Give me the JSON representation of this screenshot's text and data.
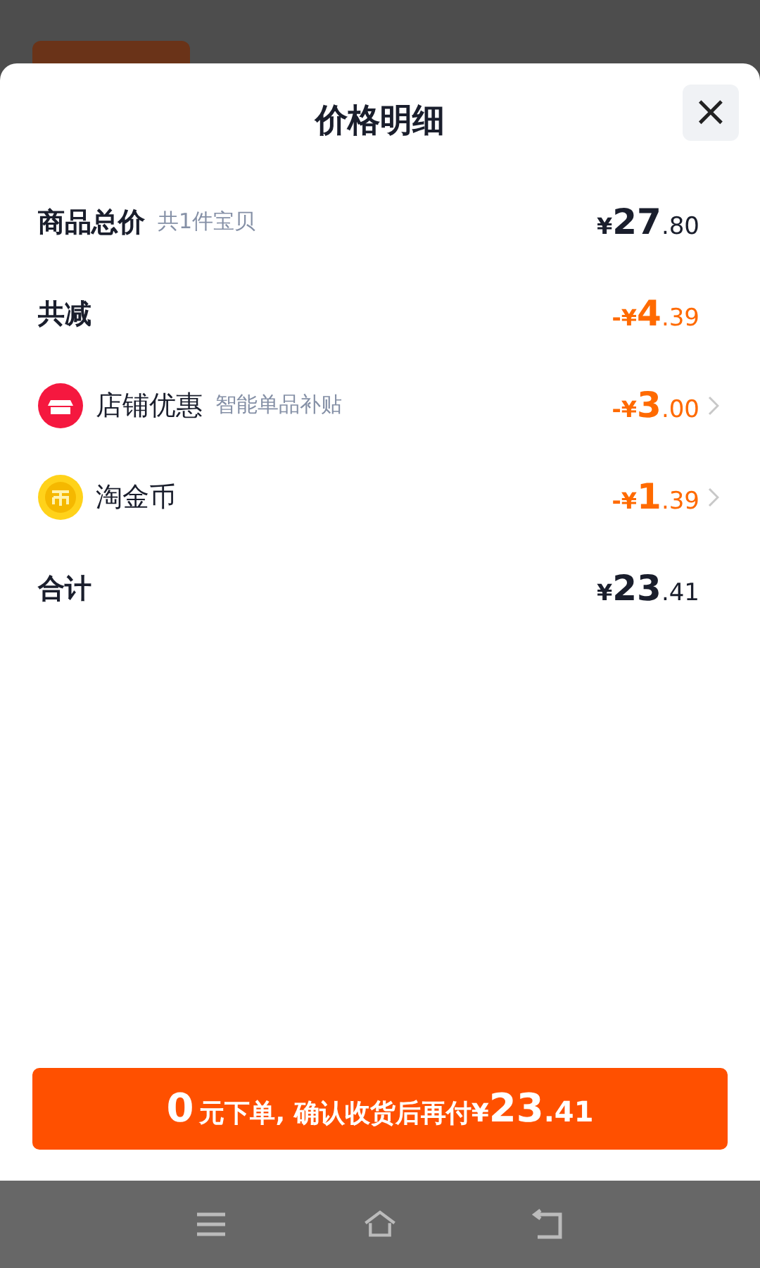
{
  "sheet": {
    "title": "价格明细",
    "close": "×"
  },
  "rows": [
    {
      "kind": "total",
      "label": "商品总价",
      "note": "共1件宝贝",
      "amount": "¥27.80"
    },
    {
      "kind": "discount",
      "label": "共减",
      "amount": "-¥4.39"
    },
    {
      "kind": "store",
      "label": "店铺优惠",
      "note": "智能单品补贴",
      "amount": "-¥3.00"
    },
    {
      "kind": "coin",
      "label": "淘金币",
      "amount": "-¥1.39"
    },
    {
      "kind": "total",
      "label": "合计",
      "amount": "¥23.41"
    }
  ],
  "confirm_button": {
    "lead": "0",
    "text": "元下单, 确认收货后再付",
    "amount": "¥23.41"
  }
}
